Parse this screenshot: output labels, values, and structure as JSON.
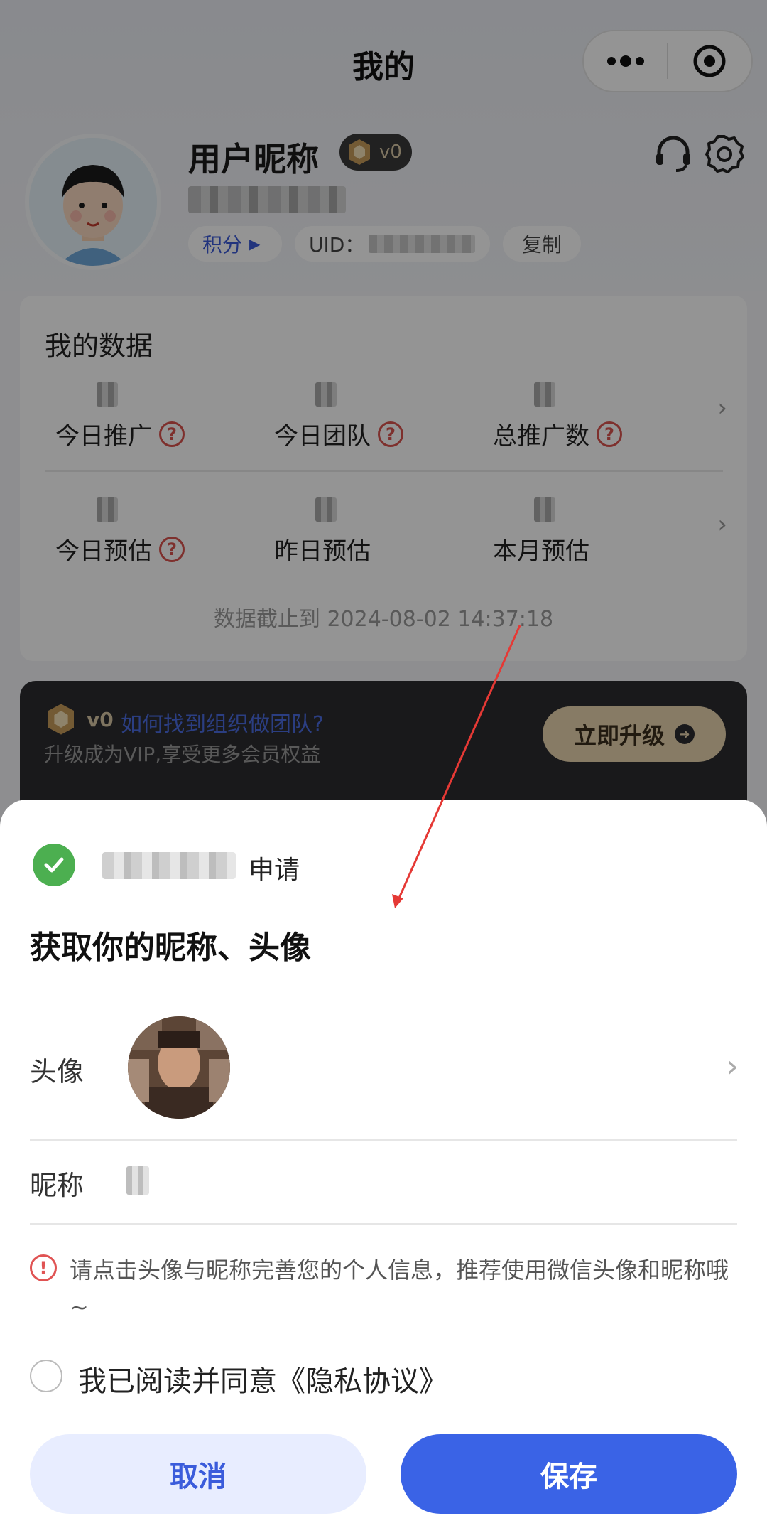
{
  "nav": {
    "title": "我的"
  },
  "profile": {
    "nickname": "用户昵称",
    "level": "v0",
    "points_label": "积分",
    "uid_label": "UID：",
    "copy_label": "复制"
  },
  "my_data": {
    "title": "我的数据",
    "row1": [
      {
        "label": "今日推广",
        "has_help": true
      },
      {
        "label": "今日团队",
        "has_help": true
      },
      {
        "label": "总推广数",
        "has_help": true
      }
    ],
    "row2": [
      {
        "label": "今日预估",
        "has_help": true
      },
      {
        "label": "昨日预估",
        "has_help": false
      },
      {
        "label": "本月预估",
        "has_help": false
      }
    ],
    "updated_at": "数据截止到 2024-08-02 14:37:18"
  },
  "vip": {
    "level": "v0",
    "link": "如何找到组织做团队?",
    "subtitle": "升级成为VIP,享受更多会员权益",
    "button": "立即升级"
  },
  "sheet": {
    "apply_text": "申请",
    "title": "获取你的昵称、头像",
    "avatar_label": "头像",
    "nickname_label": "昵称",
    "notice": "请点击头像与昵称完善您的个人信息，推荐使用微信头像和昵称哦~",
    "agree_text": "我已阅读并同意《隐私协议》",
    "cancel": "取消",
    "save": "保存"
  },
  "colors": {
    "primary": "#3a63e6",
    "cancel_bg": "#e8edff",
    "warn": "#e05353",
    "success": "#4caf50",
    "vip_gold": "#e8d4ae",
    "annotation": "#e53935"
  }
}
